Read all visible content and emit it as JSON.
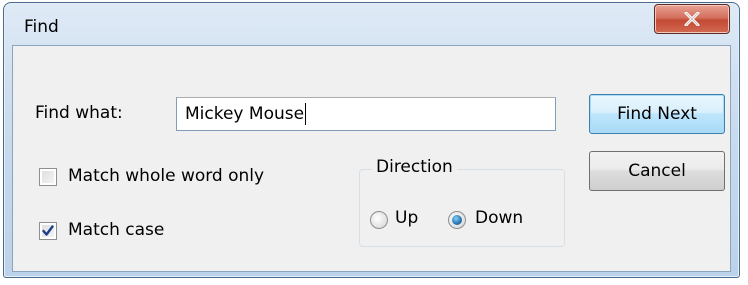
{
  "window": {
    "title": "Find"
  },
  "find_what": {
    "label": "Find what:",
    "value": "Mickey Mouse"
  },
  "buttons": {
    "find_next": "Find Next",
    "cancel": "Cancel"
  },
  "options": {
    "match_whole_word": {
      "label": "Match whole word only",
      "checked": false
    },
    "match_case": {
      "label": "Match case",
      "checked": true
    }
  },
  "direction": {
    "title": "Direction",
    "up": {
      "label": "Up",
      "selected": false
    },
    "down": {
      "label": "Down",
      "selected": true
    }
  },
  "icons": {
    "close": "close-icon",
    "check": "checkmark-icon"
  },
  "colors": {
    "close_button": "#c8503b",
    "default_button_border": "#3c7fb1",
    "window_frame": "#bcd2ea"
  }
}
